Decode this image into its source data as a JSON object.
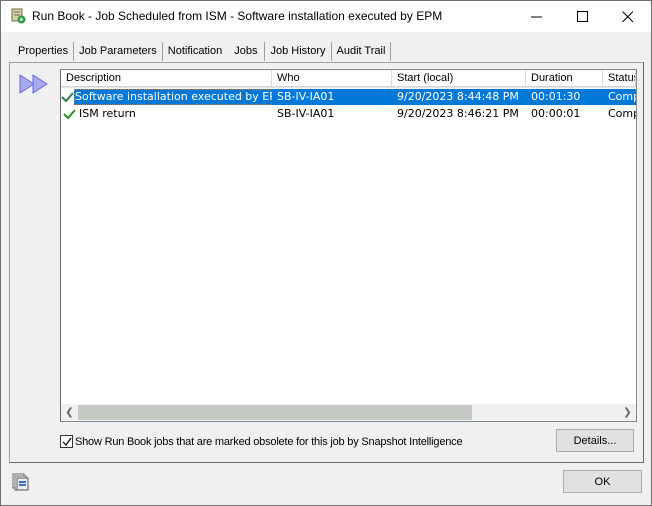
{
  "window": {
    "title": "Run Book - Job Scheduled from ISM - Software installation executed by EPM",
    "app_icon": "runbook-scroll-icon",
    "controls": {
      "minimize": "minimize-icon",
      "maximize": "maximize-icon",
      "close": "close-icon"
    }
  },
  "tabs": [
    {
      "label": "Properties",
      "active": false
    },
    {
      "label": "Job Parameters",
      "active": false
    },
    {
      "label": "Notification",
      "active": false
    },
    {
      "label": "Jobs",
      "active": true
    },
    {
      "label": "Job History",
      "active": false
    },
    {
      "label": "Audit Trail",
      "active": false
    }
  ],
  "jobs_table": {
    "columns": [
      "Description",
      "Who",
      "Start (local)",
      "Duration",
      "Status"
    ],
    "rows": [
      {
        "status_icon": "check-icon",
        "description": "Software installation executed by EPM",
        "who": "SB-IV-IA01",
        "start": "9/20/2023 8:44:48 PM",
        "duration": "00:01:30",
        "status": "Completed",
        "selected": true
      },
      {
        "status_icon": "check-icon",
        "description": "ISM return",
        "who": "SB-IV-IA01",
        "start": "9/20/2023 8:46:21 PM",
        "duration": "00:00:01",
        "status": "Completed",
        "selected": false
      }
    ]
  },
  "show_obsolete": {
    "label": "Show Run Book jobs that are marked obsolete for this job by Snapshot Intelligence",
    "checked": true
  },
  "buttons": {
    "details": "Details...",
    "ok": "OK"
  },
  "colors": {
    "selection": "#0078d7",
    "check": "#2e7d32",
    "play_icon": "#9a9ae8"
  }
}
